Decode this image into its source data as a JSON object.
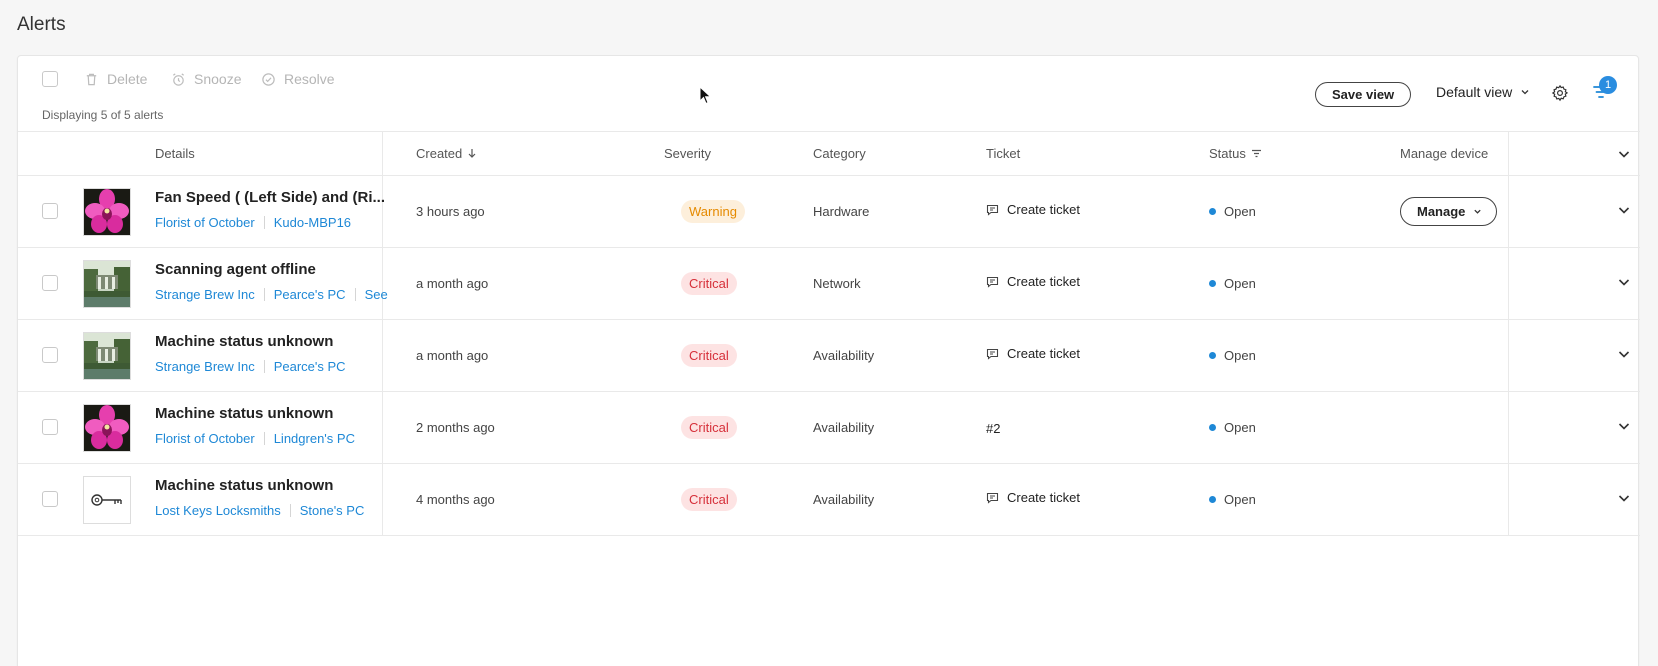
{
  "page": {
    "title": "Alerts"
  },
  "toolbar": {
    "actions": [
      {
        "label": "Delete",
        "icon": "trash-icon"
      },
      {
        "label": "Snooze",
        "icon": "alarm-icon"
      },
      {
        "label": "Resolve",
        "icon": "check-circle-icon"
      }
    ],
    "count_text": "Displaying 5 of 5 alerts",
    "save_view_label": "Save view",
    "view_select_label": "Default view",
    "filter_badge": "1"
  },
  "columns": {
    "details": "Details",
    "created": "Created",
    "severity": "Severity",
    "category": "Category",
    "ticket": "Ticket",
    "status": "Status",
    "manage_device": "Manage device"
  },
  "rows": [
    {
      "title": "Fan Speed ( (Left Side) and (Ri...",
      "thumb": "orchid",
      "links": [
        "Florist of October",
        "Kudo-MBP16"
      ],
      "created": "3 hours ago",
      "severity": "Warning",
      "category": "Hardware",
      "ticket": "Create ticket",
      "status": "Open",
      "manage": "Manage"
    },
    {
      "title": "Scanning agent offline",
      "thumb": "garden",
      "links": [
        "Strange Brew Inc",
        "Pearce's PC",
        "See"
      ],
      "created": "a month ago",
      "severity": "Critical",
      "category": "Network",
      "ticket": "Create ticket",
      "status": "Open"
    },
    {
      "title": "Machine status unknown",
      "thumb": "garden",
      "links": [
        "Strange Brew Inc",
        "Pearce's PC"
      ],
      "created": "a month ago",
      "severity": "Critical",
      "category": "Availability",
      "ticket": "Create ticket",
      "status": "Open"
    },
    {
      "title": "Machine status unknown",
      "thumb": "orchid",
      "links": [
        "Florist of October",
        "Lindgren's PC"
      ],
      "created": "2 months ago",
      "severity": "Critical",
      "category": "Availability",
      "ticket": "#2",
      "status": "Open"
    },
    {
      "title": "Machine status unknown",
      "thumb": "key",
      "links": [
        "Lost Keys Locksmiths",
        "Stone's PC"
      ],
      "created": "4 months ago",
      "severity": "Critical",
      "category": "Availability",
      "ticket": "Create ticket",
      "status": "Open"
    }
  ],
  "colors": {
    "accent": "#1e88d6",
    "warning": "#e58a00",
    "critical": "#d6303a"
  }
}
